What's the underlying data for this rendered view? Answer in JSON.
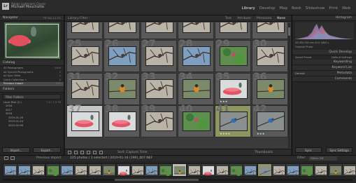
{
  "identity": {
    "line1": "Adobe Lightroom Classic",
    "name": "Michaël Mouchotte"
  },
  "modules": [
    "Library",
    "Develop",
    "Map",
    "Book",
    "Slideshow",
    "Print",
    "Web"
  ],
  "left": {
    "navigator_title": "Navigator",
    "navigator_zoom": "FIT  FILL  1:1  3:1",
    "catalog_title": "Catalog",
    "catalog_items": [
      {
        "label": "All Photographs",
        "count": "2580"
      },
      {
        "label": "All Synced Photographs",
        "count": "0"
      },
      {
        "label": "All Sync Ditto",
        "count": "0"
      },
      {
        "label": "Quick Collection +",
        "count": "0"
      },
      {
        "label": "Previous Import",
        "count": "220"
      }
    ],
    "folders_title": "Folders",
    "filter_folders": "Filter Folders",
    "volume": {
      "label": "Local Disk (C:)",
      "count": "1.5 / 1.9 TB"
    },
    "folder_rows": [
      {
        "label": "2016",
        "count": ""
      },
      {
        "label": "2017",
        "count": ""
      },
      {
        "label": "2018",
        "count": ""
      },
      {
        "label": "2019-01-16",
        "count": ""
      },
      {
        "label": "2019-01-24",
        "count": ""
      },
      {
        "label": "2019-02-08",
        "count": ""
      }
    ],
    "import_label": "Import...",
    "export_label": "Export..."
  },
  "filter_bar": {
    "label": "Library Filter :",
    "options": [
      "Text",
      "Attribute",
      "Metadata",
      "None"
    ],
    "active": "None"
  },
  "grid": {
    "cells": [
      {
        "num": "",
        "scene": "branch",
        "stars": ""
      },
      {
        "num": "",
        "scene": "branch",
        "stars": ""
      },
      {
        "num": "",
        "scene": "branch",
        "stars": ""
      },
      {
        "num": "",
        "scene": "branch",
        "stars": ""
      },
      {
        "num": "",
        "scene": "branch",
        "stars": ""
      },
      {
        "num": "",
        "scene": "branch",
        "stars": ""
      },
      {
        "num": "25",
        "scene": "branch",
        "stars": ""
      },
      {
        "num": "26",
        "scene": "blue-sky",
        "stars": ""
      },
      {
        "num": "27",
        "scene": "branch",
        "stars": ""
      },
      {
        "num": "28",
        "scene": "blue-sky",
        "stars": ""
      },
      {
        "num": "29",
        "scene": "green",
        "stars": ""
      },
      {
        "num": "30",
        "scene": "branch",
        "stars": ""
      },
      {
        "num": "31",
        "scene": "branch",
        "stars": ""
      },
      {
        "num": "32",
        "scene": "orange-bird",
        "stars": ""
      },
      {
        "num": "33",
        "scene": "branch",
        "stars": ""
      },
      {
        "num": "34",
        "scene": "orange-bird",
        "stars": ""
      },
      {
        "num": "35",
        "scene": "feeder",
        "stars": "★★★"
      },
      {
        "num": "36",
        "scene": "orange-bird",
        "stars": ""
      },
      {
        "num": "37",
        "scene": "feeder",
        "stars": "",
        "state": "sel"
      },
      {
        "num": "38",
        "scene": "feeder",
        "stars": ""
      },
      {
        "num": "39",
        "scene": "branch",
        "stars": ""
      },
      {
        "num": "40",
        "scene": "green",
        "stars": ""
      },
      {
        "num": "41",
        "scene": "blue-bird",
        "stars": "★★★★",
        "state": "hl"
      },
      {
        "num": "42",
        "scene": "blue-bird",
        "stars": "★★★"
      }
    ]
  },
  "toolbar": {
    "sort_label": "Sort: Capture Time",
    "right_label": "Thumbnails"
  },
  "right": {
    "histogram_title": "Histogram",
    "histogram_info": "ISO 800   300 mm   f/5.6   1/800 s",
    "original_photo": "Original Photo",
    "quick_develop": "Quick Develop",
    "saved_preset": "Saved Preset",
    "preset_value": "Default Settings",
    "keywording": "Keywording",
    "keyword_list": "Keyword List",
    "metadata": "Metadata",
    "metadata_preset": "Default",
    "comments": "Comments",
    "sync_label": "Sync",
    "sync_settings_label": "Sync Settings"
  },
  "filmstrip_bar": {
    "source": "Previous Import",
    "count_info": "225 photos / 1 selected / 2019-01-16 (190)_007.NEF",
    "filter_label": "Filter:",
    "filter_value": "Filters Off"
  },
  "filmstrip": [
    {
      "scene": "blue-sky"
    },
    {
      "scene": "blue-sky"
    },
    {
      "scene": "branch"
    },
    {
      "scene": "green"
    },
    {
      "scene": "blue-sky"
    },
    {
      "scene": "branch"
    },
    {
      "scene": "branch"
    },
    {
      "scene": "orange-bird"
    },
    {
      "scene": "feeder"
    },
    {
      "scene": "branch"
    },
    {
      "scene": "blue-sky"
    },
    {
      "scene": "green"
    },
    {
      "scene": "orange-bird",
      "state": "sel"
    },
    {
      "scene": "branch"
    },
    {
      "scene": "feeder"
    },
    {
      "scene": "branch"
    },
    {
      "scene": "green"
    },
    {
      "scene": "blue-sky"
    },
    {
      "scene": "blue-bird",
      "state": "hl"
    },
    {
      "scene": "branch"
    },
    {
      "scene": "blue-sky"
    },
    {
      "scene": "green"
    },
    {
      "scene": "branch"
    },
    {
      "scene": "orange-bird"
    },
    {
      "scene": "branch"
    }
  ],
  "scene_colors": {
    "branch": "#b9b3a8",
    "blue-sky": "#7f9fc0",
    "green": "#5f8f4f",
    "orange-bird": "#7a8a6a",
    "feeder": "#d9dcdc",
    "blue-bird": "#8a8f90"
  },
  "accent": {
    "selection": "#c5c5c5",
    "target": "#8f9560",
    "active_text": "#e8e8e8"
  }
}
